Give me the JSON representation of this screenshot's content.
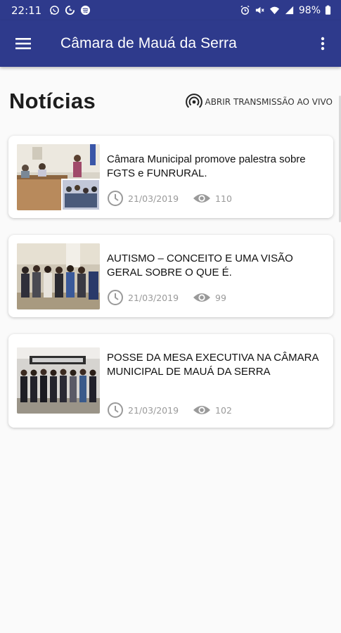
{
  "status_bar": {
    "time": "22:11",
    "battery": "98%",
    "icons": [
      "whatsapp-icon",
      "data-saver-icon",
      "spotify-icon",
      "alarm-icon",
      "mute-icon",
      "wifi-icon",
      "signal-icon",
      "battery-icon"
    ]
  },
  "app_bar": {
    "title": "Câmara de Mauá da Serra",
    "menu_icon": "hamburger-menu-icon",
    "overflow_icon": "more-vertical-icon"
  },
  "page": {
    "title": "Notícias",
    "live_button_label": "ABRIR TRANSMISSÃO AO VIVO",
    "live_icon": "broadcast-icon"
  },
  "news": [
    {
      "title": "Câmara Municipal promove palestra sobre FGTS e FUNRURAL.",
      "date": "21/03/2019",
      "views": "110"
    },
    {
      "title": "AUTISMO – CONCEITO E UMA VISÃO GERAL SOBRE O QUE É.",
      "date": "21/03/2019",
      "views": "99"
    },
    {
      "title": "POSSE DA MESA EXECUTIVA NA CÂMARA MUNICIPAL DE MAUÁ DA SERRA",
      "date": "21/03/2019",
      "views": "102"
    }
  ],
  "colors": {
    "primary": "#2e3a8c",
    "background": "#fafafa",
    "meta_text": "#9a9a9a"
  }
}
